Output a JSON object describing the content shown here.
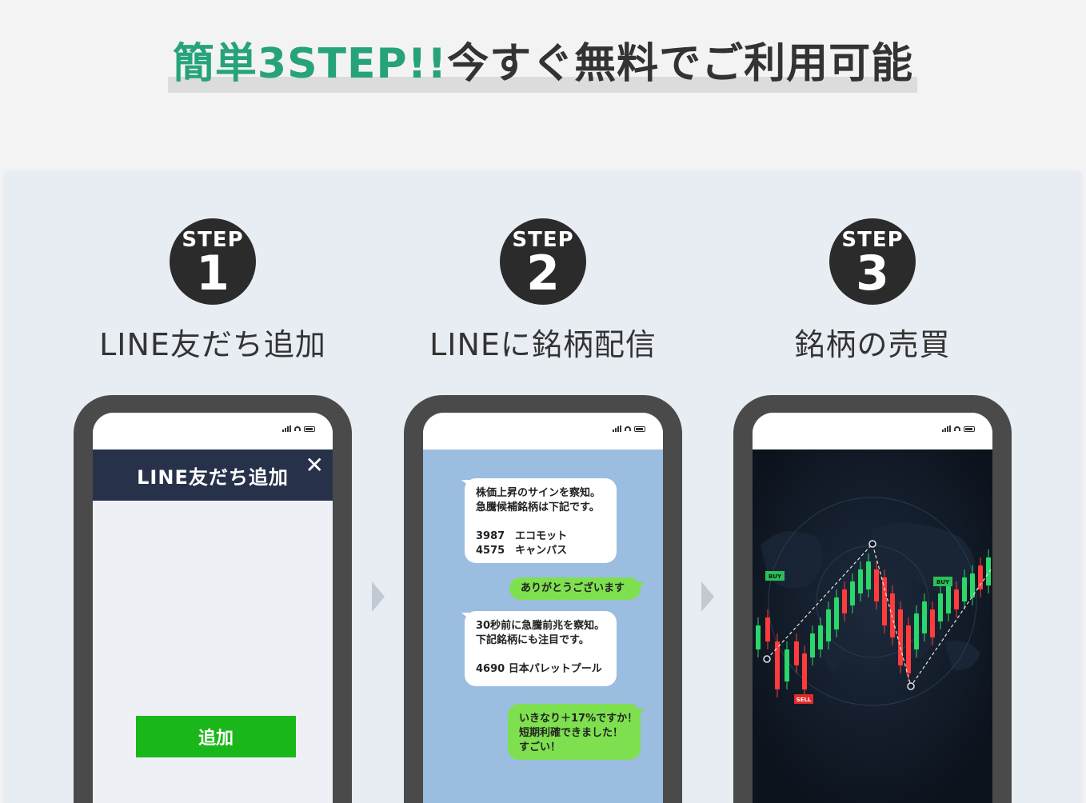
{
  "title": {
    "highlight": "簡単3STEP!!",
    "rest": "今すぐ無料でご利用可能"
  },
  "steps": [
    {
      "label": "STEP",
      "number": "1",
      "title": "LINE友だち追加"
    },
    {
      "label": "STEP",
      "number": "2",
      "title": "LINEに銘柄配信"
    },
    {
      "label": "STEP",
      "number": "3",
      "title": "銘柄の売買"
    }
  ],
  "phone1": {
    "header": "LINE友だち追加",
    "close": "✕",
    "button": "追加"
  },
  "phone2": {
    "messages": [
      {
        "side": "left",
        "lines": [
          "株価上昇のサインを察知。",
          "急騰候補銘柄は下記です。",
          "",
          "3987　エコモット",
          "4575　キャンパス"
        ]
      },
      {
        "side": "right",
        "lines": [
          "ありがとうございます"
        ]
      },
      {
        "side": "left",
        "lines": [
          "30秒前に急騰前兆を察知。",
          "下記銘柄にも注目です。",
          "",
          "4690 日本パレットプール"
        ]
      },
      {
        "side": "right",
        "lines": [
          "いきなり＋17%ですか！",
          "短期利確できました！",
          "すごい！"
        ]
      }
    ]
  },
  "phone3": {
    "buy1": "BUY",
    "buy2": "BUY",
    "sell": "SELL"
  },
  "colors": {
    "accent": "#26a37b",
    "line_green": "#1ab71a",
    "bubble_green": "#7fe04f",
    "chat_bg": "#9bbde0",
    "header_navy": "#27324a"
  }
}
